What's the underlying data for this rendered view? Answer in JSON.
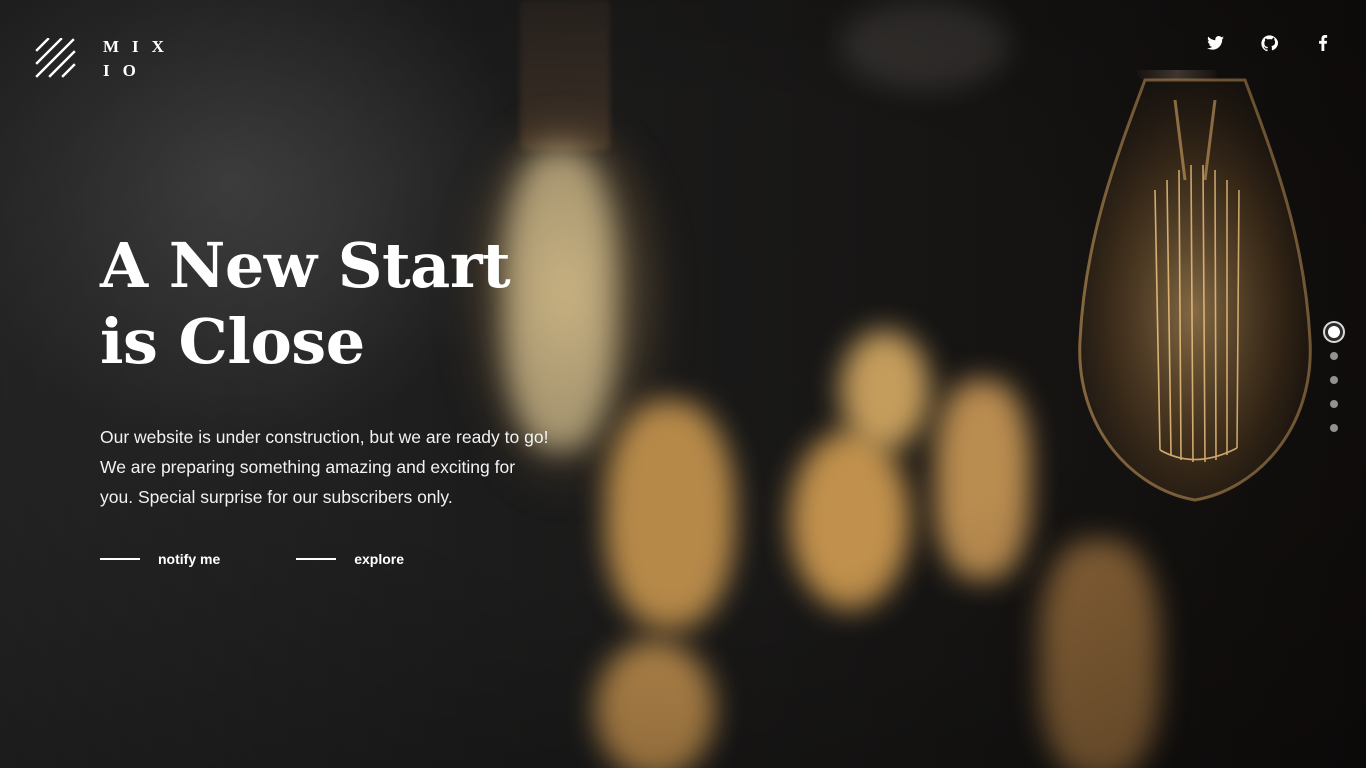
{
  "brand": {
    "line1": "MIX",
    "line2": "IO"
  },
  "social": [
    {
      "name": "Twitter",
      "icon": "twitter-icon"
    },
    {
      "name": "GitHub",
      "icon": "github-icon"
    },
    {
      "name": "Facebook",
      "icon": "facebook-icon"
    }
  ],
  "hero": {
    "title_line1": "A New Start",
    "title_line2": "is Close",
    "text_line1": "Our website is under construction, but we are ready to go!",
    "text_line2": "We are preparing something amazing and exciting for",
    "text_line3": "you. Special surprise for our subscribers only."
  },
  "actions": {
    "notify_label": "notify me",
    "explore_label": "explore"
  },
  "slides": {
    "count": 5,
    "active_index": 0
  },
  "colors": {
    "text": "#ffffff",
    "background": "#141414",
    "bulb_glow": "#e7b46a"
  }
}
